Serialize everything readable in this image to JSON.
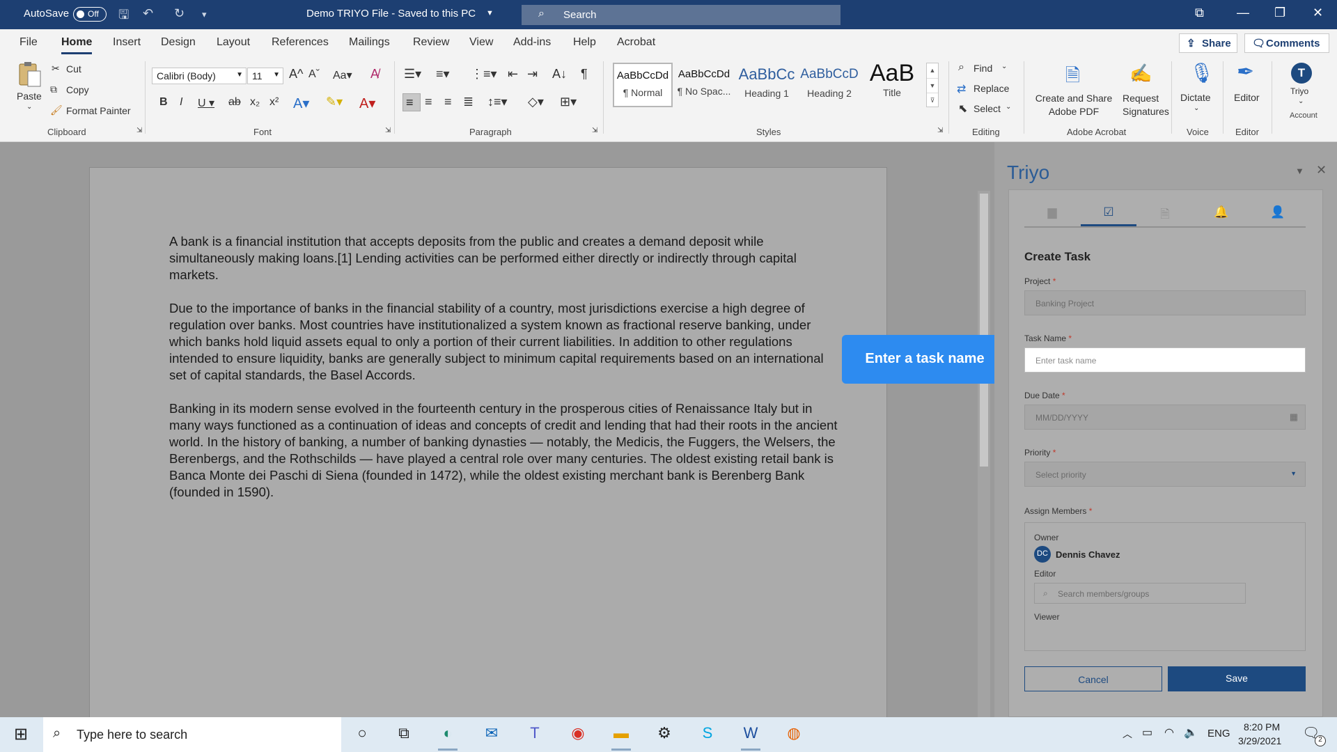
{
  "titlebar": {
    "autosave_label": "AutoSave",
    "autosave_state": "Off",
    "doc_title": "Demo TRIYO File  -  Saved to this PC",
    "search_placeholder": "Search"
  },
  "ribbon_tabs": [
    "File",
    "Home",
    "Insert",
    "Design",
    "Layout",
    "References",
    "Mailings",
    "Review",
    "View",
    "Add-ins",
    "Help",
    "Acrobat"
  ],
  "active_tab": "Home",
  "share_label": "Share",
  "comments_label": "Comments",
  "clipboard": {
    "paste": "Paste",
    "cut": "Cut",
    "copy": "Copy",
    "format_painter": "Format Painter",
    "group": "Clipboard"
  },
  "font": {
    "name": "Calibri (Body)",
    "size": "11",
    "group": "Font"
  },
  "paragraph_group": "Paragraph",
  "styles": {
    "items": [
      {
        "preview": "AaBbCcDd",
        "name": "¶ Normal"
      },
      {
        "preview": "AaBbCcDd",
        "name": "¶ No Spac..."
      },
      {
        "preview": "AaBbCc",
        "name": "Heading 1"
      },
      {
        "preview": "AaBbCcD",
        "name": "Heading 2"
      },
      {
        "preview": "AaB",
        "name": "Title"
      }
    ],
    "group": "Styles"
  },
  "editing": {
    "find": "Find",
    "replace": "Replace",
    "select": "Select",
    "group": "Editing"
  },
  "acrobat": {
    "create_share": "Create and Share Adobe PDF",
    "request_sig": "Request Signatures",
    "group": "Adobe Acrobat"
  },
  "voice": {
    "dictate": "Dictate",
    "group": "Voice"
  },
  "editor": {
    "label": "Editor",
    "group": "Editor"
  },
  "account": {
    "initial": "T",
    "name": "Triyo",
    "group": "Account"
  },
  "document": {
    "paragraphs": [
      "A bank is a financial institution that accepts deposits from the public and creates a demand deposit while simultaneously making loans.[1] Lending activities can be performed either directly or indirectly through capital markets.",
      "Due to the importance of banks in the financial stability of a country, most jurisdictions exercise a high degree of regulation over banks. Most countries have institutionalized a system known as fractional reserve banking, under which banks hold liquid assets equal to only a portion of their current liabilities. In addition to other regulations intended to ensure liquidity, banks are generally subject to minimum capital requirements based on an international set of capital standards, the Basel Accords.",
      "Banking in its modern sense evolved in the fourteenth century in the prosperous cities of Renaissance Italy but in many ways functioned as a continuation of ideas and concepts of credit and lending that had their roots in the ancient world. In the history of banking, a number of banking dynasties — notably, the Medicis, the Fuggers, the Welsers, the Berenbergs, and the Rothschilds — have played a central role over many centuries. The oldest existing retail bank is Banca Monte dei Paschi di Siena (founded in 1472), while the oldest existing merchant bank is Berenberg Bank (founded in 1590)."
    ]
  },
  "tooltip": "Enter a task name",
  "pane": {
    "title": "Triyo",
    "form_title": "Create Task",
    "project_label": "Project",
    "project_value": "Banking Project",
    "task_name_label": "Task Name",
    "task_name_placeholder": "Enter task name",
    "due_date_label": "Due Date",
    "due_date_placeholder": "MM/DD/YYYY",
    "priority_label": "Priority",
    "priority_placeholder": "Select priority",
    "assign_label": "Assign Members",
    "owner_label": "Owner",
    "owner_initials": "DC",
    "owner_name": "Dennis Chavez",
    "editor_label": "Editor",
    "members_placeholder": "Search members/groups",
    "viewer_label": "Viewer",
    "cancel": "Cancel",
    "save": "Save",
    "required_mark": "*"
  },
  "taskbar": {
    "search_placeholder": "Type here to search",
    "lang": "ENG",
    "time": "8:20 PM",
    "date": "3/29/2021",
    "notification_count": "2"
  },
  "colors": {
    "titlebar": "#1d3f72",
    "accent": "#1d4a80",
    "tooltip": "#2d8bf0"
  }
}
